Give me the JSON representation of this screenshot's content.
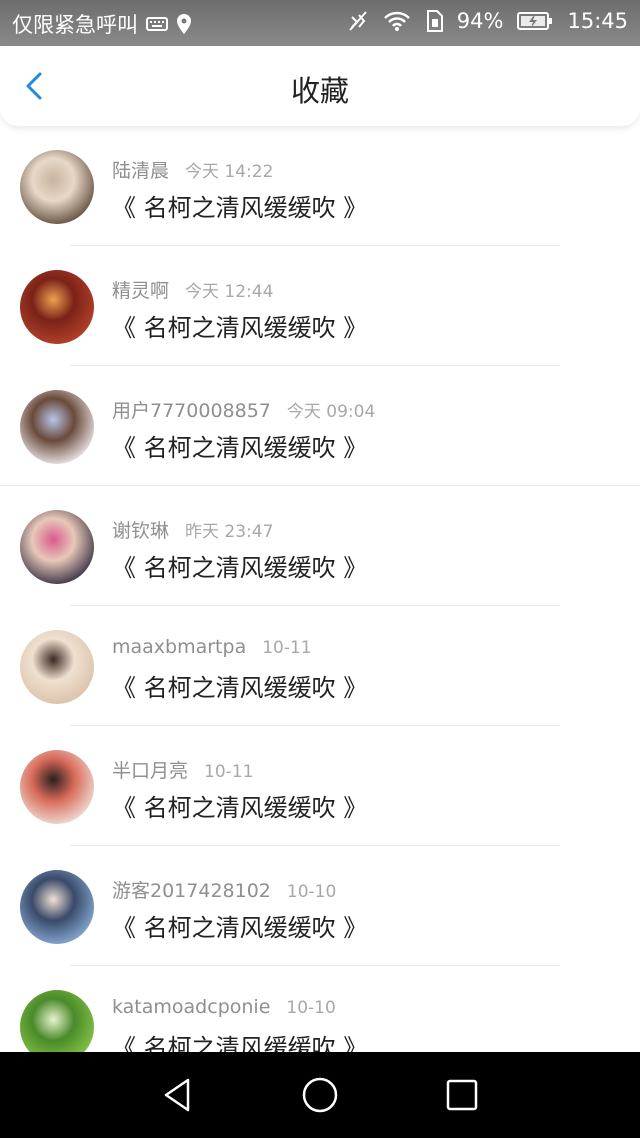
{
  "status_bar": {
    "carrier": "仅限紧急呼叫",
    "battery": "94%",
    "time": "15:45"
  },
  "header": {
    "title": "收藏"
  },
  "favorites": [
    {
      "user": "陆清晨",
      "time": "今天 14:22",
      "text": "《 名柯之清风缓缓吹 》",
      "avatar_colors": [
        "#5a4636",
        "#c8b49e",
        "#e8d8c8"
      ]
    },
    {
      "user": "精灵啊",
      "time": "今天 12:44",
      "text": "《 名柯之清风缓缓吹 》",
      "avatar_colors": [
        "#b8442c",
        "#f0a050",
        "#7a2218"
      ]
    },
    {
      "user": "用户7770008857",
      "time": "今天 09:04",
      "text": "《 名柯之清风缓缓吹 》",
      "avatar_colors": [
        "#f4f0f4",
        "#b8c4e8",
        "#6a4a3a"
      ]
    },
    {
      "user": "谢钦琳",
      "time": "昨天 23:47",
      "text": "《 名柯之清风缓缓吹 》",
      "avatar_colors": [
        "#2e2a3e",
        "#d85a8e",
        "#e8c8b8"
      ]
    },
    {
      "user": "maaxbmartpa",
      "time": "10-11",
      "text": "《 名柯之清风缓缓吹 》",
      "avatar_colors": [
        "#d8c0a8",
        "#3a2a22",
        "#f0e0d0"
      ]
    },
    {
      "user": "半口月亮",
      "time": "10-11",
      "text": "《 名柯之清风缓缓吹 》",
      "avatar_colors": [
        "#f0e4dc",
        "#2a2020",
        "#d86a58"
      ]
    },
    {
      "user": "游客2017428102",
      "time": "10-10",
      "text": "《 名柯之清风缓缓吹 》",
      "avatar_colors": [
        "#8ab0d8",
        "#f0e0d4",
        "#3a4a6a"
      ]
    },
    {
      "user": "katamoadcponie",
      "time": "10-10",
      "text": "《 名柯之清风缓缓吹 》",
      "avatar_colors": [
        "#8ac84a",
        "#e8f4d0",
        "#4a8a2a"
      ]
    }
  ],
  "colors": {
    "accent": "#1e88e5",
    "title_text": "#222222",
    "meta_text": "#8f8f8f"
  }
}
